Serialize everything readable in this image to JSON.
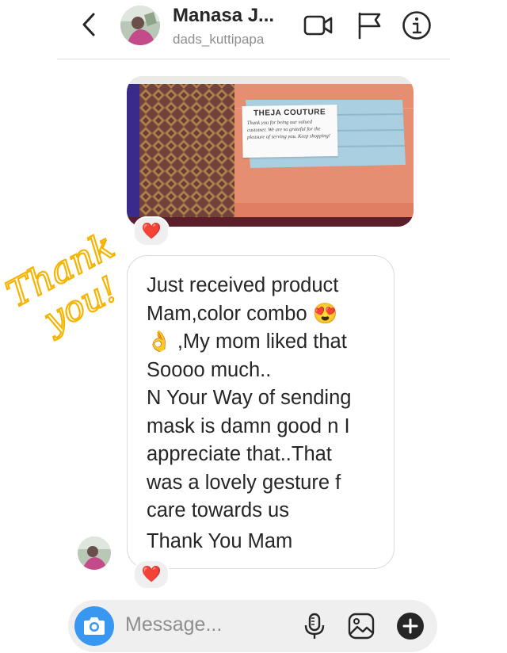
{
  "header": {
    "name": "Manasa J...",
    "username": "dads_kuttipapa"
  },
  "icons": {
    "back": "chevron-left-icon",
    "video": "video-camera-icon",
    "flag": "flag-icon",
    "info": "info-icon",
    "camera": "camera-icon",
    "mic": "microphone-icon",
    "gallery": "image-gallery-icon",
    "plus": "plus-icon",
    "reaction": "heart-emoji"
  },
  "photo_card": {
    "brand": "THEJA COUTURE",
    "note": "Thank you for being our valued customer. We are so grateful for the pleasure of serving you. Keep shopping!"
  },
  "reactions": {
    "image": "❤️",
    "text": "❤️"
  },
  "message": {
    "lines": [
      "Just received product",
      "Mam,color combo 😍",
      "👌 ,My mom liked that",
      "Soooo much..",
      "N Your Way of sending",
      "mask is damn good n I",
      "appreciate that..That",
      "was a lovely gesture f",
      "care towards us"
    ],
    "closing": "Thank You Mam"
  },
  "sticker": {
    "line1": "Thank",
    "line2": "you!",
    "color": "#f5b400"
  },
  "composer": {
    "placeholder": "Message..."
  },
  "colors": {
    "accent": "#3897f0",
    "muted_text": "#8e8e8e",
    "border": "#dbdbdb"
  }
}
